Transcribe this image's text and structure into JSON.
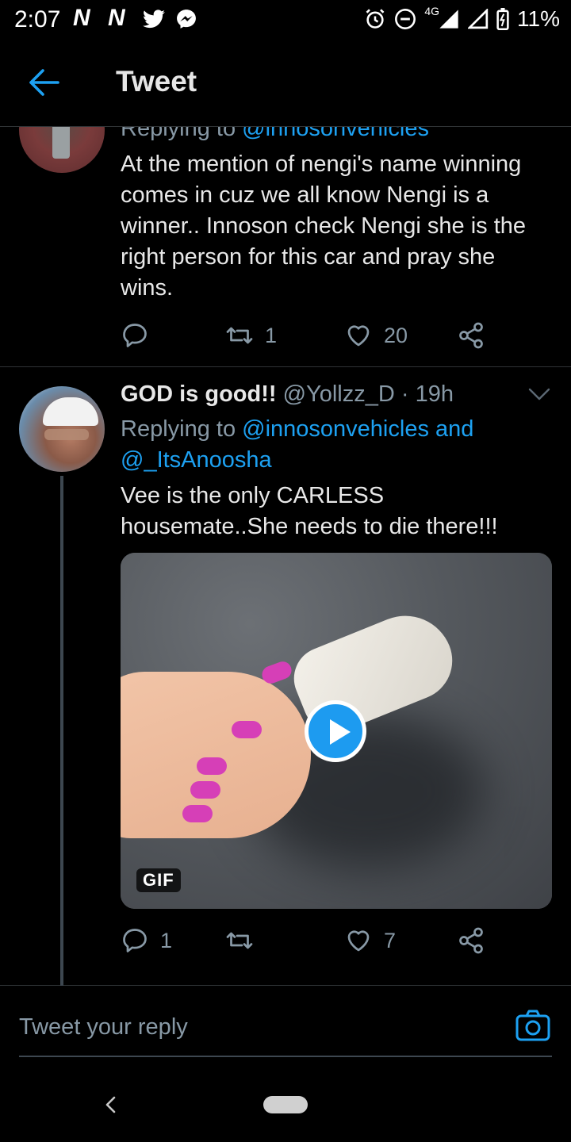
{
  "status_bar": {
    "time": "2:07",
    "notification_glyphs": [
      "N",
      "N"
    ],
    "network": "4G",
    "battery": "11%"
  },
  "header": {
    "title": "Tweet"
  },
  "tweet1": {
    "replying_prefix": "Replying to ",
    "replying_handle": "@innosonvehicles",
    "text": "At the mention of nengi's name winning comes in cuz we all know Nengi is a winner.. Innoson check Nengi she is the right person for this car and pray she wins.",
    "retweets": "1",
    "likes": "20"
  },
  "tweet2": {
    "name": "GOD is good!!",
    "handle": "@Yollzz_D",
    "time": "· 19h",
    "replying_prefix": "Replying to ",
    "replying_handles": "@innosonvehicles and @_ItsAnoosha",
    "text": "Vee is the only CARLESS housemate..She needs to die there!!!",
    "media_badge": "GIF",
    "replies": "1",
    "likes": "7"
  },
  "reply": {
    "placeholder": "Tweet your reply"
  },
  "colors": {
    "accent": "#1da1f2",
    "muted": "#8899a6",
    "background": "#000000"
  },
  "icons": [
    "back-arrow-icon",
    "reply-icon",
    "retweet-icon",
    "like-icon",
    "share-icon",
    "chevron-down-icon",
    "play-icon",
    "camera-icon"
  ]
}
